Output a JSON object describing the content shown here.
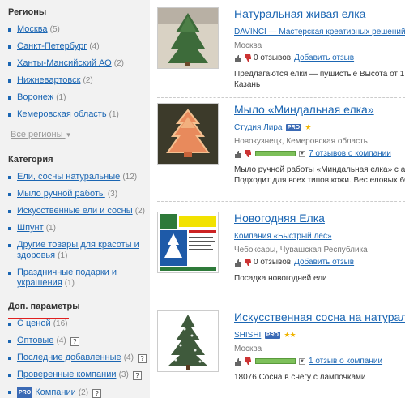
{
  "sidebar": {
    "regions": {
      "title": "Регионы",
      "items": [
        {
          "label": "Москва",
          "count": "(5)"
        },
        {
          "label": "Санкт-Петербург",
          "count": "(4)"
        },
        {
          "label": "Ханты-Мансийский АО",
          "count": "(2)"
        },
        {
          "label": "Нижневартовск",
          "count": "(2)"
        },
        {
          "label": "Воронеж",
          "count": "(1)"
        },
        {
          "label": "Кемеровская область",
          "count": "(1)"
        }
      ],
      "more": "Все регионы"
    },
    "categories": {
      "title": "Категория",
      "items": [
        {
          "label": "Ели, сосны натуральные",
          "count": "(12)"
        },
        {
          "label": "Мыло ручной работы",
          "count": "(3)"
        },
        {
          "label": "Искусственные ели и сосны",
          "count": "(2)"
        },
        {
          "label": "Шпунт",
          "count": "(1)"
        },
        {
          "label": "Другие товары для красоты и здоровья",
          "count": "(1)"
        },
        {
          "label": "Праздничные подарки и украшения",
          "count": "(1)"
        }
      ]
    },
    "params": {
      "title": "Доп. параметры",
      "items": [
        {
          "label": "С ценой",
          "count": "(16)"
        },
        {
          "label": "Оптовые",
          "count": "(4)"
        },
        {
          "label": "Последние добавленные",
          "count": "(4)"
        },
        {
          "label": "Проверенные компании",
          "count": "(3)"
        },
        {
          "label": "Компании",
          "count": "(2)",
          "pro": "PRO"
        }
      ],
      "help": "?"
    }
  },
  "listings": [
    {
      "title": "Натуральная живая елка",
      "company": "DAVINCI — Мастерская креативных решений",
      "city": "Москва",
      "reviews": "0 отзывов",
      "action": "Добавить отзыв",
      "desc": [
        "Предлагаются елки — пушистые Высота от 1",
        "Казань"
      ]
    },
    {
      "title": "Мыло «Миндальная елка»",
      "company": "Студия Лира",
      "badge": "PRO",
      "city": "Новокузнецк, Кемеровская область",
      "reviews": "7 отзывов о компании",
      "rating": 0.85,
      "desc": [
        "Мыло ручной работы «Миндальная елка» с ар",
        "Подходит для всех типов кожи. Вес еловых 60"
      ]
    },
    {
      "title": "Новогодняя Елка",
      "company": "Компания «Быстрый лес»",
      "city": "Чебоксары, Чувашская Республика",
      "reviews": "0 отзывов",
      "action": "Добавить отзыв",
      "desc": [
        "Посадка новогодней ели"
      ]
    },
    {
      "title": "Искусственная сосна на натурал",
      "company": "SHISHI",
      "badge": "PRO",
      "stars": 2,
      "city": "Москва",
      "reviews": "1 отзыв о компании",
      "rating": 0.8,
      "desc": [
        "18076 Сосна в снегу с лампочками"
      ]
    }
  ],
  "colors": {
    "link": "#1b66b3",
    "sidebar_bg": "#f2f2f2",
    "rating_bar": "#7dc05a",
    "pro_badge": "#3b6ab5",
    "highlight": "#e02020"
  }
}
